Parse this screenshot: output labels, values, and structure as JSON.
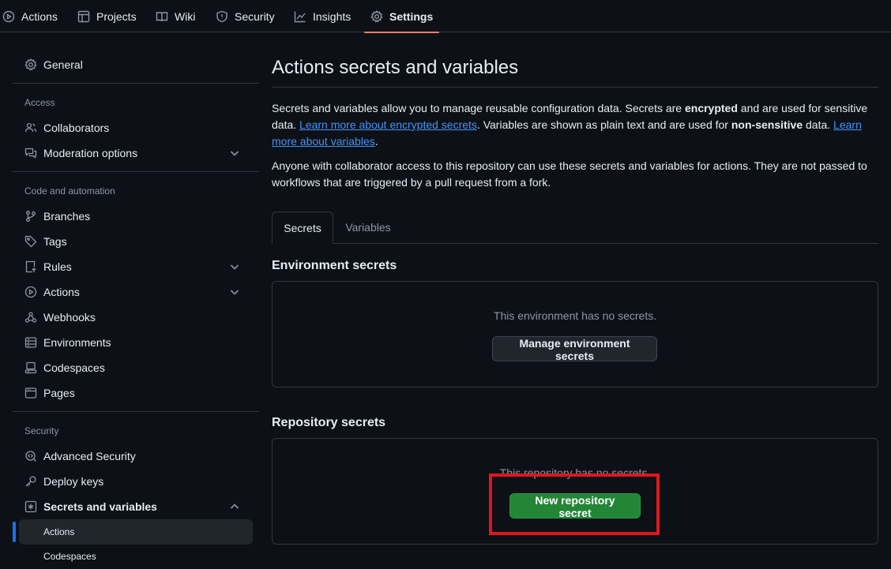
{
  "topnav": {
    "tabs": [
      {
        "label": "Actions",
        "icon": "play-icon"
      },
      {
        "label": "Projects",
        "icon": "table-icon"
      },
      {
        "label": "Wiki",
        "icon": "book-icon"
      },
      {
        "label": "Security",
        "icon": "shield-icon"
      },
      {
        "label": "Insights",
        "icon": "graph-icon"
      },
      {
        "label": "Settings",
        "icon": "gear-icon",
        "active": true
      }
    ]
  },
  "sidebar": {
    "general": "General",
    "access_heading": "Access",
    "collaborators": "Collaborators",
    "moderation": "Moderation options",
    "code_heading": "Code and automation",
    "branches": "Branches",
    "tags": "Tags",
    "rules": "Rules",
    "actions": "Actions",
    "webhooks": "Webhooks",
    "environments": "Environments",
    "codespaces": "Codespaces",
    "pages": "Pages",
    "security_heading": "Security",
    "advanced_security": "Advanced Security",
    "deploy_keys": "Deploy keys",
    "secrets_variables": "Secrets and variables",
    "sub_actions": "Actions",
    "sub_codespaces": "Codespaces"
  },
  "main": {
    "title": "Actions secrets and variables",
    "intro": {
      "t1": "Secrets and variables allow you to manage reusable configuration data. Secrets are ",
      "b1": "encrypted",
      "t2": " and are used for sensitive data. ",
      "link1": "Learn more about encrypted secrets",
      "t3": ". Variables are shown as plain text and are used for ",
      "b2": "non-sensitive",
      "t4": " data. ",
      "link2": "Learn more about variables",
      "t5": "."
    },
    "access_note": "Anyone with collaborator access to this repository can use these secrets and variables for actions. They are not passed to workflows that are triggered by a pull request from a fork.",
    "tabs": [
      "Secrets",
      "Variables"
    ],
    "env_title": "Environment secrets",
    "env_empty": "This environment has no secrets.",
    "env_button": "Manage environment secrets",
    "repo_title": "Repository secrets",
    "repo_empty": "This repository has no secrets.",
    "repo_button": "New repository secret"
  },
  "colors": {
    "accent_underline": "#f78166",
    "link": "#4493f8",
    "primary_button": "#238636",
    "annotation_box": "#e0161e"
  }
}
